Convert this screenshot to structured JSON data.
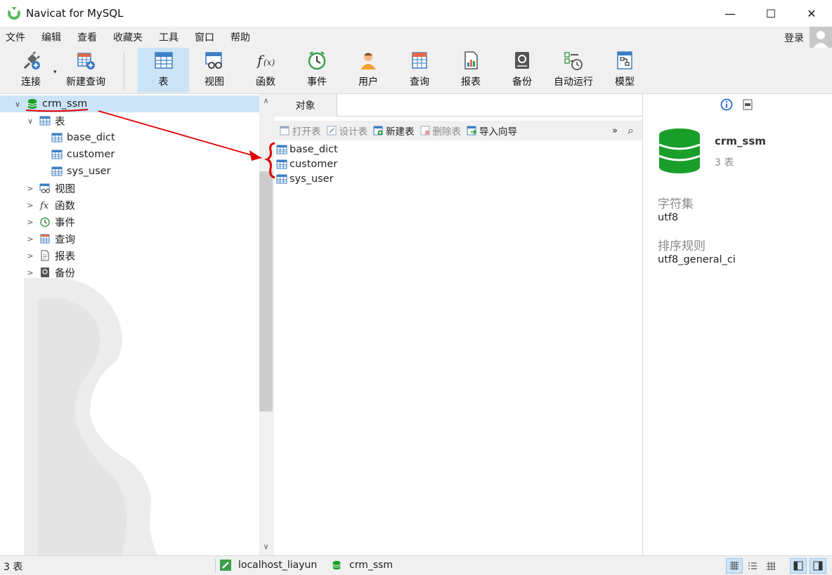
{
  "window": {
    "title": "Navicat for MySQL",
    "minimize_glyph": "—",
    "maximize_glyph": "☐",
    "close_glyph": "✕"
  },
  "menu": {
    "items": [
      "文件",
      "编辑",
      "查看",
      "收藏夹",
      "工具",
      "窗口",
      "帮助"
    ],
    "login": "登录"
  },
  "toolbar": {
    "connect": "连接",
    "new_query": "新建查询",
    "table": "表",
    "view": "视图",
    "function": "函数",
    "event": "事件",
    "user": "用户",
    "query": "查询",
    "report": "报表",
    "backup": "备份",
    "automation": "自动运行",
    "model": "模型",
    "dropdown_caret": "▾"
  },
  "tree": {
    "database": "crm_ssm",
    "tables_node": "表",
    "tables": [
      "base_dict",
      "customer",
      "sys_user"
    ],
    "views": "视图",
    "functions": "函数",
    "events": "事件",
    "queries": "查询",
    "reports": "报表",
    "backups": "备份",
    "expanded_glyph": "∨",
    "collapsed_glyph": ">"
  },
  "objects": {
    "tab": "对象",
    "open_table": "打开表",
    "design_table": "设计表",
    "new_table": "新建表",
    "delete_table": "删除表",
    "import_wizard": "导入向导",
    "more_glyph": "»",
    "search_glyph": "⌕",
    "list": [
      "base_dict",
      "customer",
      "sys_user"
    ]
  },
  "info": {
    "name": "crm_ssm",
    "count": "3 表",
    "charset_label": "字符集",
    "charset": "utf8",
    "collation_label": "排序规则",
    "collation": "utf8_general_ci"
  },
  "status": {
    "count": "3 表",
    "connection": "localhost_liayun",
    "database": "crm_ssm"
  },
  "scrollbar": {
    "up_glyph": "∧",
    "down_glyph": "∨"
  },
  "colors": {
    "accent": "#cce4f7",
    "db_green": "#1a9e2a",
    "table_blue": "#3c7fc4",
    "annotation_red": "#e00000"
  }
}
